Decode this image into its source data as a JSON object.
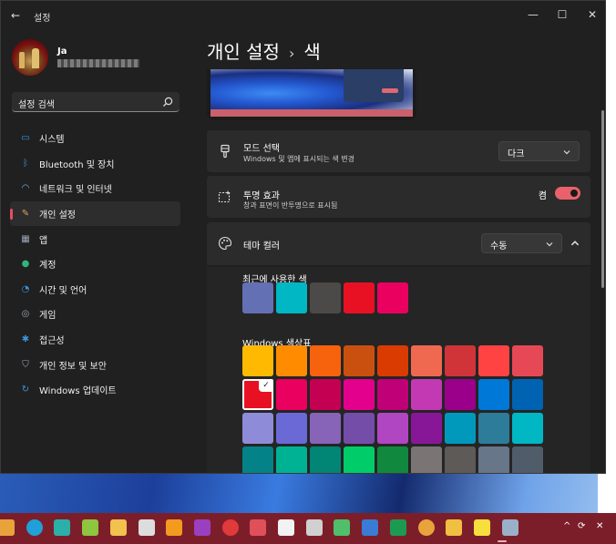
{
  "window": {
    "app_title": "설정",
    "back_glyph": "←",
    "minimize_glyph": "—",
    "maximize_glyph": "☐",
    "close_glyph": "✕"
  },
  "profile": {
    "name": "Ja"
  },
  "search": {
    "value": "설정 검색",
    "icon": "search-icon"
  },
  "sidebar": {
    "items": [
      {
        "label": "시스템",
        "icon": "system-icon",
        "color": "#3a96dd"
      },
      {
        "label": "Bluetooth 및 장치",
        "icon": "bluetooth-icon",
        "color": "#3a96dd"
      },
      {
        "label": "네트워크 및 인터넷",
        "icon": "wifi-icon",
        "color": "#6db8f0"
      },
      {
        "label": "개인 설정",
        "icon": "brush-icon",
        "color": "#e0a060",
        "active": true
      },
      {
        "label": "앱",
        "icon": "apps-icon",
        "color": "#9aa6b8"
      },
      {
        "label": "계정",
        "icon": "account-icon",
        "color": "#2fb67a"
      },
      {
        "label": "시간 및 언어",
        "icon": "globe-clock-icon",
        "color": "#3a96dd"
      },
      {
        "label": "게임",
        "icon": "gamepad-icon",
        "color": "#9aa6b8"
      },
      {
        "label": "접근성",
        "icon": "accessibility-icon",
        "color": "#3a96dd"
      },
      {
        "label": "개인 정보 및 보안",
        "icon": "shield-icon",
        "color": "#9aa6b8"
      },
      {
        "label": "Windows 업데이트",
        "icon": "update-icon",
        "color": "#3a96dd"
      }
    ]
  },
  "breadcrumb": {
    "parent": "개인 설정",
    "separator": "›",
    "current": "색"
  },
  "mode": {
    "title": "모드 선택",
    "subtitle": "Windows 및 앱에 표시되는 색 변경",
    "value": "다크"
  },
  "transparency": {
    "title": "투명 효과",
    "subtitle": "창과 표면이 반투명으로 표시됨",
    "state_label": "켬",
    "on": true
  },
  "accent": {
    "title": "테마 컬러",
    "value": "수동"
  },
  "recent_colors": {
    "label": "최근에 사용한 색",
    "swatches": [
      "#6470b4",
      "#00b7c3",
      "#4c4a48",
      "#e81123",
      "#ea005e"
    ]
  },
  "windows_colors": {
    "label": "Windows 색상표",
    "selected_index": 9,
    "swatches": [
      "#ffb900",
      "#ff8c00",
      "#f7630c",
      "#ca5010",
      "#da3b01",
      "#ef6950",
      "#d13438",
      "#ff4343",
      "#e74856",
      "#e81123",
      "#ea005e",
      "#c30052",
      "#e3008c",
      "#bf0077",
      "#c239b3",
      "#9a0089",
      "#0078d7",
      "#0063b1",
      "#8e8cd8",
      "#6b69d6",
      "#8764b8",
      "#744da9",
      "#b146c2",
      "#881798",
      "#0099bc",
      "#2d7d9a",
      "#00b7c3",
      "#038387",
      "#00b294",
      "#018574",
      "#00cc6a",
      "#10893e",
      "#7a7574",
      "#5d5a58",
      "#68768a",
      "#515c6b"
    ]
  },
  "taskbar": {
    "icons": [
      {
        "name": "explorer-icon",
        "color": "#e8a33a"
      },
      {
        "name": "edge-icon",
        "color": "#1fa0d6"
      },
      {
        "name": "vero-icon",
        "color": "#2ab0a8"
      },
      {
        "name": "photos-icon",
        "color": "#8dc63f"
      },
      {
        "name": "presentation-icon",
        "color": "#f2c14e"
      },
      {
        "name": "chess-icon",
        "color": "#dddddd"
      },
      {
        "name": "search-app-icon",
        "color": "#f29b1e"
      },
      {
        "name": "onenote-icon",
        "color": "#9a3fc0"
      },
      {
        "name": "record-icon",
        "color": "#e03a3a"
      },
      {
        "name": "stripes-icon",
        "color": "#e0505a"
      },
      {
        "name": "capcut-icon",
        "color": "#f2f2f2"
      },
      {
        "name": "document-icon",
        "color": "#d0d0d0"
      },
      {
        "name": "tree-icon",
        "color": "#4fbf6a"
      },
      {
        "name": "capture-icon",
        "color": "#3a7bd5"
      },
      {
        "name": "excel-icon",
        "color": "#1d9a52"
      },
      {
        "name": "chrome-icon",
        "color": "#e8a33a"
      },
      {
        "name": "messenger-icon",
        "color": "#f0c040"
      },
      {
        "name": "kakaotalk-icon",
        "color": "#f7e03c"
      },
      {
        "name": "settings-icon",
        "color": "#9ab0c8"
      }
    ],
    "tray": {
      "up": "^",
      "sync": "⟳",
      "close": "✕"
    }
  }
}
